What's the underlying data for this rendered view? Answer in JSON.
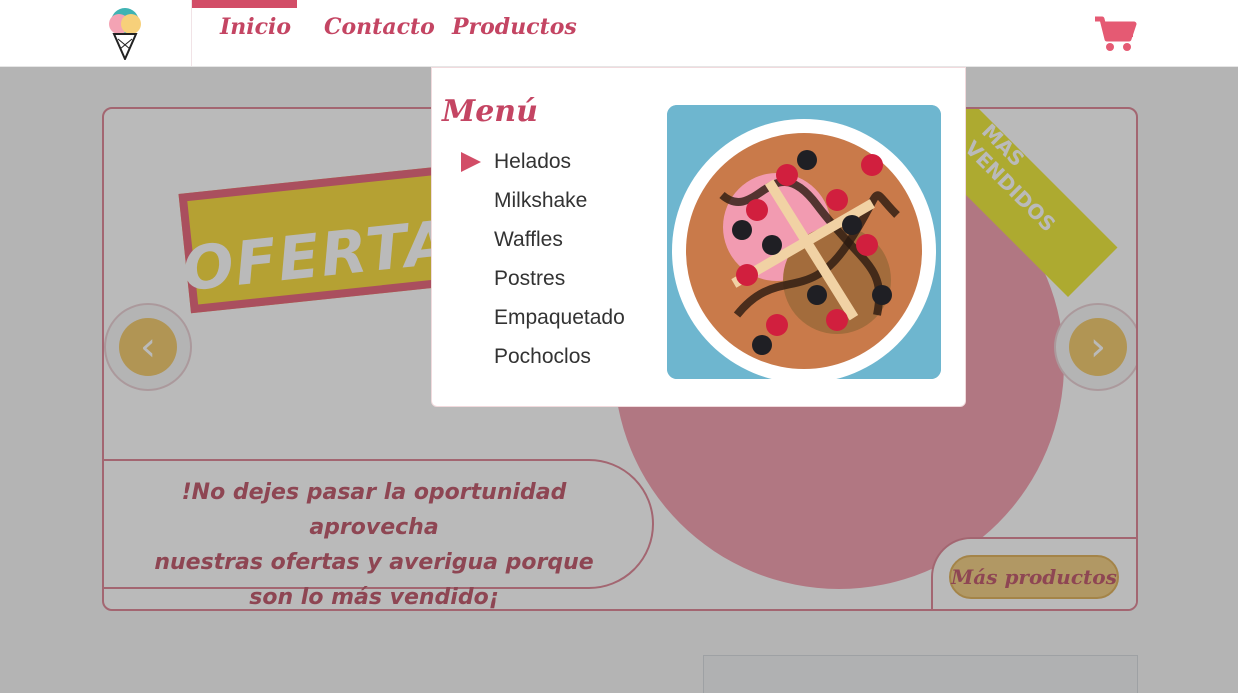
{
  "nav": {
    "items": [
      "Inicio",
      "Contacto",
      "Productos"
    ],
    "active": "Inicio"
  },
  "banner": {
    "ofertas_text": "OFERTAS",
    "ribbon_text": "MÁS VENDIDOS",
    "promo_lines": [
      "!No dejes pasar la oportunidad aprovecha",
      "nuestras ofertas y averigua porque",
      "son lo más vendido¡"
    ],
    "more_button": "Más productos"
  },
  "dropdown": {
    "title": "Menú",
    "items": [
      "Helados",
      "Milkshake",
      "Waffles",
      "Postres",
      "Empaquetado",
      "Pochoclos"
    ],
    "selected": "Helados"
  },
  "colors": {
    "brand": "#d24d67",
    "accent_yellow": "#efc050",
    "overlay": "rgba(90,90,90,0.42)"
  },
  "icons": {
    "logo": "ice-cream-logo-icon",
    "cart": "shopping-cart-icon",
    "prev": "chevron-left-icon",
    "next": "chevron-right-icon",
    "pointer": "triangle-right-icon"
  }
}
